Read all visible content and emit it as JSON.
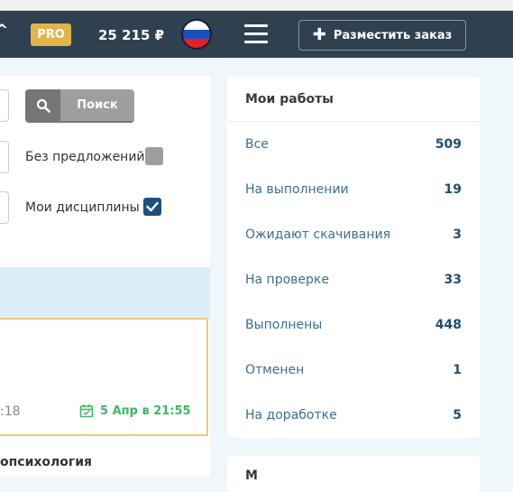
{
  "header": {
    "pro_label": "PRO",
    "balance": "25 215 ₽",
    "place_order_label": "Разместить заказ",
    "icons": [
      "chevron-up-icon",
      "flag-russia-icon",
      "menu-icon",
      "plus-icon"
    ],
    "colors": {
      "background": "#2f4051",
      "pro_badge": "#e2b44a"
    }
  },
  "filters": {
    "search_label": "Поиск",
    "no_offers_label": "Без предложений",
    "no_offers_checked": false,
    "my_disciplines_label": "Мои дисциплины",
    "my_disciplines_checked": true
  },
  "order_card": {
    "time_partial": ":18",
    "deadline": "5 Апр в 21:55",
    "colors": {
      "border": "#ecc878",
      "deadline": "#3eb766"
    }
  },
  "next_item_title": "опсихология",
  "my_works": {
    "title": "Мои работы",
    "items": [
      {
        "label": "Все",
        "count": "509"
      },
      {
        "label": "На выполнении",
        "count": "19"
      },
      {
        "label": "Ожидают скачивания",
        "count": "3"
      },
      {
        "label": "На проверке",
        "count": "33"
      },
      {
        "label": "Выполнены",
        "count": "448"
      },
      {
        "label": "Отменен",
        "count": "1"
      },
      {
        "label": "На доработке",
        "count": "5"
      }
    ]
  },
  "second_panel_title": "М"
}
